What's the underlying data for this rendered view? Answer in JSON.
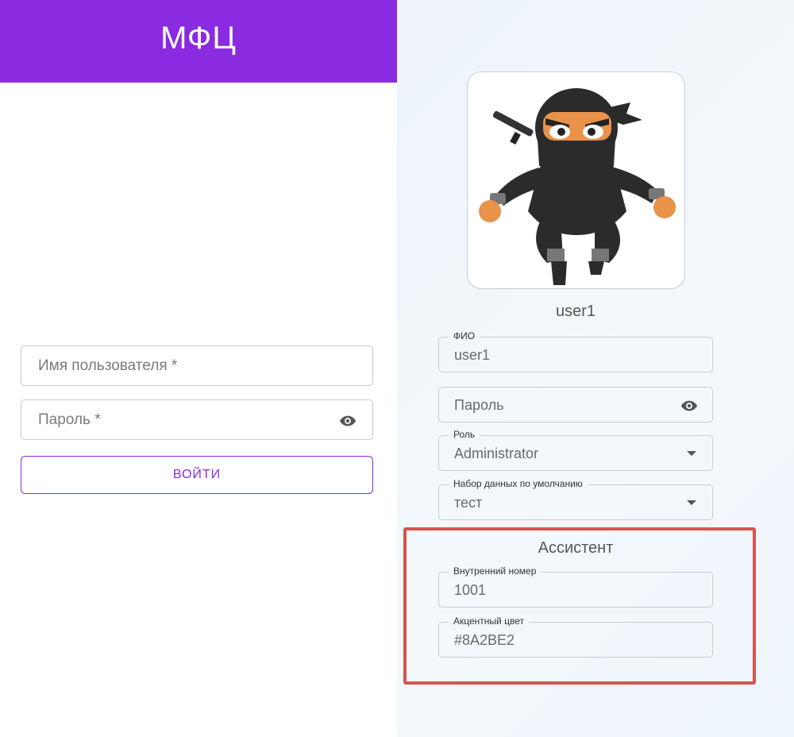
{
  "login": {
    "app_title": "МФЦ",
    "username_placeholder": "Имя пользователя *",
    "password_placeholder": "Пароль *",
    "login_button": "ВОЙТИ"
  },
  "profile": {
    "avatar_icon": "ninja-avatar",
    "username": "user1",
    "fio_label": "ФИО",
    "fio_value": "user1",
    "password_placeholder": "Пароль",
    "role_label": "Роль",
    "role_value": "Administrator",
    "dataset_label": "Набор данных по умолчанию",
    "dataset_value": "тест",
    "assistant": {
      "title": "Ассистент",
      "ext_label": "Внутренний номер",
      "ext_value": "1001",
      "color_label": "Акцентный цвет",
      "color_value": "#8A2BE2"
    }
  },
  "colors": {
    "accent": "#8a2be2",
    "highlight": "#d9534f"
  }
}
